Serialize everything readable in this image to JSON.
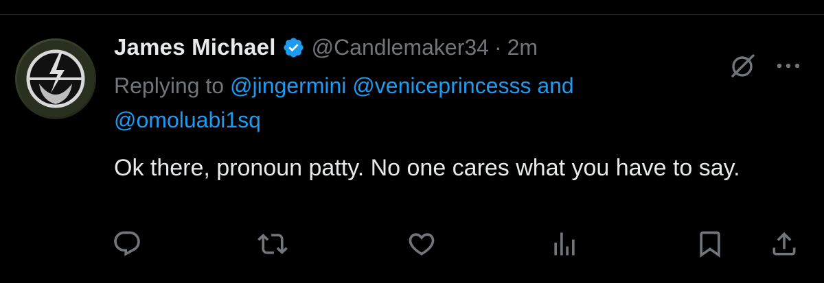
{
  "tweet": {
    "display_name": "James Michael",
    "handle": "@Candlemaker34",
    "separator": "·",
    "time": "2m",
    "replying_prefix": "Replying to",
    "mentions": [
      "@jingermini",
      "@veniceprincesss"
    ],
    "mentions_joiner": "and",
    "last_mention": "@omoluabi1sq",
    "text": "Ok there,  pronoun patty. No one cares what you have to say."
  },
  "colors": {
    "background": "#000000",
    "text_primary": "#e7e9ea",
    "text_secondary": "#71767b",
    "accent": "#1d9bf0"
  },
  "icons": {
    "verified": "verified-badge-icon",
    "grok": "grok-icon",
    "more": "more-icon",
    "reply": "reply-icon",
    "repost": "repost-icon",
    "like": "like-icon",
    "views": "views-icon",
    "bookmark": "bookmark-icon",
    "share": "share-icon"
  }
}
